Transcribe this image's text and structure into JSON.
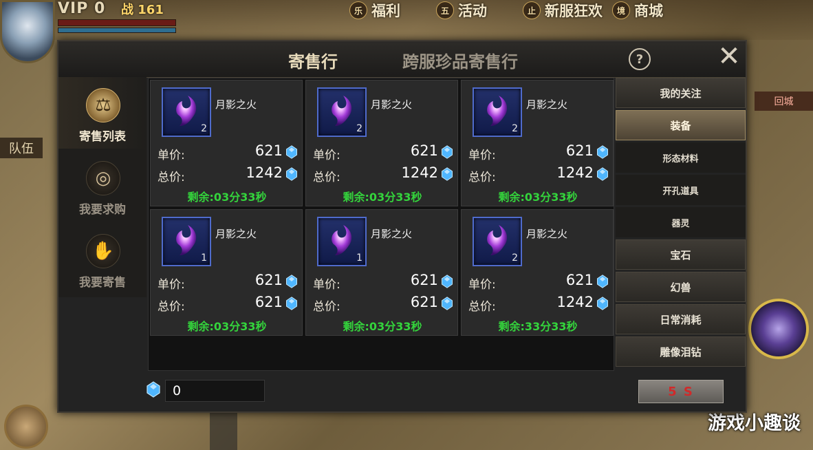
{
  "hud": {
    "vip": "VIP 0",
    "power": "战 161",
    "top_buttons": [
      {
        "badge": "乐",
        "label": "福利"
      },
      {
        "badge": "五",
        "label": "活动"
      },
      {
        "badge": "止",
        "label": "新服狂欢"
      },
      {
        "badge": "境",
        "label": "商城"
      }
    ],
    "team_label": "队伍",
    "return_label": "回城",
    "watermark": "游戏小趣谈"
  },
  "dialog": {
    "tab_active": "寄售行",
    "tab_other": "跨服珍品寄售行",
    "help": "?",
    "close": "✕"
  },
  "left_nav": [
    {
      "label": "寄售列表",
      "icon": "scroll-icon",
      "glyph": "⚖"
    },
    {
      "label": "我要求购",
      "icon": "coin-hand-icon",
      "glyph": "◎"
    },
    {
      "label": "我要寄售",
      "icon": "moneybag-hand-icon",
      "glyph": "✋"
    }
  ],
  "listings": [
    {
      "name": "月影之火",
      "qty": "2",
      "unit_label": "单价:",
      "unit_price": "621",
      "total_label": "总价:",
      "total_price": "1242",
      "timer": "剩余:03分33秒"
    },
    {
      "name": "月影之火",
      "qty": "2",
      "unit_label": "单价:",
      "unit_price": "621",
      "total_label": "总价:",
      "total_price": "1242",
      "timer": "剩余:03分33秒"
    },
    {
      "name": "月影之火",
      "qty": "2",
      "unit_label": "单价:",
      "unit_price": "621",
      "total_label": "总价:",
      "total_price": "1242",
      "timer": "剩余:03分33秒"
    },
    {
      "name": "月影之火",
      "qty": "1",
      "unit_label": "单价:",
      "unit_price": "621",
      "total_label": "总价:",
      "total_price": "621",
      "timer": "剩余:03分33秒"
    },
    {
      "name": "月影之火",
      "qty": "1",
      "unit_label": "单价:",
      "unit_price": "621",
      "total_label": "总价:",
      "total_price": "621",
      "timer": "剩余:03分33秒"
    },
    {
      "name": "月影之火",
      "qty": "2",
      "unit_label": "单价:",
      "unit_price": "621",
      "total_label": "总价:",
      "total_price": "1242",
      "timer": "剩余:33分33秒"
    }
  ],
  "categories": {
    "items": [
      {
        "label": "我的关注",
        "kind": "cat"
      },
      {
        "label": "装备",
        "kind": "cat-selected"
      },
      {
        "label": "形态材料",
        "kind": "sub"
      },
      {
        "label": "开孔道具",
        "kind": "sub"
      },
      {
        "label": "器灵",
        "kind": "sub"
      },
      {
        "label": "宝石",
        "kind": "cat"
      },
      {
        "label": "幻兽",
        "kind": "cat"
      },
      {
        "label": "日常消耗",
        "kind": "cat"
      },
      {
        "label": "雕像泪钻",
        "kind": "cat"
      }
    ]
  },
  "bottom": {
    "currency_value": "0",
    "refresh_label": "5 S"
  },
  "colors": {
    "timer_green": "#34d43c",
    "gem_blue": "#4fb6ff",
    "refresh_red": "#d12a2a",
    "slot_border": "#4f6bcd"
  }
}
